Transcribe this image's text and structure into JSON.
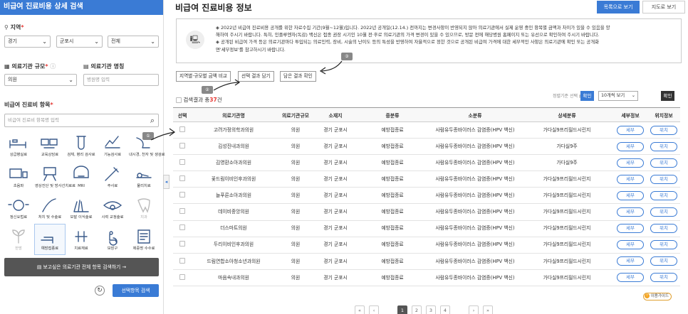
{
  "sidebar": {
    "header": "비급여 진료비용 상세 검색",
    "region_label": "지역",
    "region_selects": [
      "경기",
      "군포시",
      "전체"
    ],
    "size_label": "의료기관 규모",
    "size_value": "의원",
    "name_label": "의료기관 명칭",
    "name_placeholder": "병원명 입력",
    "category_label": "비급여 진료비 항목",
    "category_placeholder": "비급여 진료비 항목명 입력",
    "categories": [
      {
        "label": "상급병실료",
        "icon": "hospital-bed-icon"
      },
      {
        "label": "교육상담료",
        "icon": "consultation-icon"
      },
      {
        "label": "검체, 병리 검사료",
        "icon": "lab-test-icon"
      },
      {
        "label": "기능검사료",
        "icon": "function-test-icon"
      },
      {
        "label": "내시경, 천자 및 생검료",
        "icon": "endoscope-icon"
      },
      {
        "label": "초음파",
        "icon": "ultrasound-icon"
      },
      {
        "label": "영상진단 및 방사선치료료",
        "icon": "radiology-icon"
      },
      {
        "label": "MRI",
        "icon": "mri-icon"
      },
      {
        "label": "주사료",
        "icon": "syringe-icon"
      },
      {
        "label": "물리치료",
        "icon": "physiotherapy-icon"
      },
      {
        "label": "정신요법료",
        "icon": "psychotherapy-icon"
      },
      {
        "label": "처치 및 수술료",
        "icon": "surgery-icon"
      },
      {
        "label": "모발 이식술료",
        "icon": "hair-transplant-icon"
      },
      {
        "label": "시력 교정술료",
        "icon": "eye-icon"
      },
      {
        "label": "치과",
        "icon": "tooth-icon"
      },
      {
        "label": "한방",
        "icon": "herbal-icon"
      },
      {
        "label": "예방접종료",
        "icon": "vaccine-icon"
      },
      {
        "label": "치료재료",
        "icon": "medical-material-icon"
      },
      {
        "label": "보장구",
        "icon": "wheelchair-icon"
      },
      {
        "label": "제증명 수수료",
        "icon": "certificate-icon"
      }
    ],
    "search_all_label": "보고싶은 의료기관 전체 항목 검색하기",
    "search_btn": "선택항목 검색"
  },
  "main": {
    "title": "비급여 진료비용 정보",
    "tab_list": "목록으로 보기",
    "tab_map": "지도로 보기",
    "notice_lines": [
      "◈ 2022년 비급여 진료비용 공개를 위한 자료수집 기간(9월~12월)입니다. 2022년 공개일(12.14.) 전까지는 변경사항이 반영되지 않아 의료기관에서 실제 운영 중인 항목별 금액과 차이가 있을 수 있음을 양",
      "해하여 주시기 바랍니다. 특히, 인플루엔자(독감) 백신은 접종 권장 시기인 10월 전·후로 의료기관의 가격 변경이 있을 수 있으므로, 방문 전에 해당병원 홈페이지 또는 유선으로 확인하여 주시기 바랍니다.",
      "◈ 공개된 비급여 가격 등은 의료기관마다 투입되는 의료인력, 장비, 시술의 난이도 등의 특성을 반영하여 자율적으로 정한 것으로 공개된 비급여 가격에 대한 세부적인 사항은 의료기관에 확인 또는 공개화",
      "면'세부정보'를 참고하시기 바랍니다."
    ],
    "buttons": [
      "지역별·규모별 금액 비교",
      "선택 결과 담기",
      "담은 결과 확인"
    ],
    "badges": [
      "①",
      "②",
      "③"
    ],
    "result_prefix": "검색결과 총",
    "result_count": "37",
    "result_suffix": "건",
    "sort_label": "정렬기준 선택",
    "ok": "확인",
    "page_size": "10개씩 보기",
    "columns": [
      "선택",
      "의료기관명",
      "의료기관규모",
      "소재지",
      "중분류",
      "소분류",
      "상세분류",
      "세부정보",
      "위치정보"
    ],
    "rows": [
      {
        "name": "고려가정의학과의원",
        "size": "의원",
        "loc": "경기 군포시",
        "mid": "예방접종료",
        "sub": "사람유두종바이러스 감염증(HPV 백신)",
        "detail": "가다실9프리필드시린지"
      },
      {
        "name": "김성진내과의원",
        "size": "의원",
        "loc": "경기 군포시",
        "mid": "예방접종료",
        "sub": "사람유두종바이러스 감염증(HPV 백신)",
        "detail": "가다실9주"
      },
      {
        "name": "김영환소아과의원",
        "size": "의원",
        "loc": "경기 군포시",
        "mid": "예방접종료",
        "sub": "사람유두종바이러스 감염증(HPV 백신)",
        "detail": "가다실9주"
      },
      {
        "name": "꽃드림이비인후과의원",
        "size": "의원",
        "loc": "경기 군포시",
        "mid": "예방접종료",
        "sub": "사람유두종바이러스 감염증(HPV 백신)",
        "detail": "가다실9프리필드시린지"
      },
      {
        "name": "늘푸른소아과의원",
        "size": "의원",
        "loc": "경기 군포시",
        "mid": "예방접종료",
        "sub": "사람유두종바이러스 감염증(HPV 백신)",
        "detail": "가다실9프리필드시린지"
      },
      {
        "name": "데이비중앙의원",
        "size": "의원",
        "loc": "경기 군포시",
        "mid": "예방접종료",
        "sub": "사람유두종바이러스 감염증(HPV 백신)",
        "detail": "가다실9프리필드시린지"
      },
      {
        "name": "더스마트의원",
        "size": "의원",
        "loc": "경기 군포시",
        "mid": "예방접종료",
        "sub": "사람유두종바이러스 감염증(HPV 백신)",
        "detail": "가다실9프리필드시린지"
      },
      {
        "name": "두리이비인후과의원",
        "size": "의원",
        "loc": "경기 군포시",
        "mid": "예방접종료",
        "sub": "사람유두종바이러스 감염증(HPV 백신)",
        "detail": "가다실9프리필드시린지"
      },
      {
        "name": "드림연합소아청소년과의원",
        "size": "의원",
        "loc": "경기 군포시",
        "mid": "예방접종료",
        "sub": "사람유두종바이러스 감염증(HPV 백신)",
        "detail": "가다실9프리필드시린지"
      },
      {
        "name": "마음속내과의원",
        "size": "의원",
        "loc": "경기 군포시",
        "mid": "예방접종료",
        "sub": "사람유두종바이러스 감염증(HPV 백신)",
        "detail": "가다실9프리필드시린지"
      }
    ],
    "detail_btn": "세부",
    "location_btn": "위치",
    "help": "이용가이드",
    "pages": [
      "1",
      "2",
      "3",
      "4"
    ],
    "accent": "#3a7bd5"
  }
}
